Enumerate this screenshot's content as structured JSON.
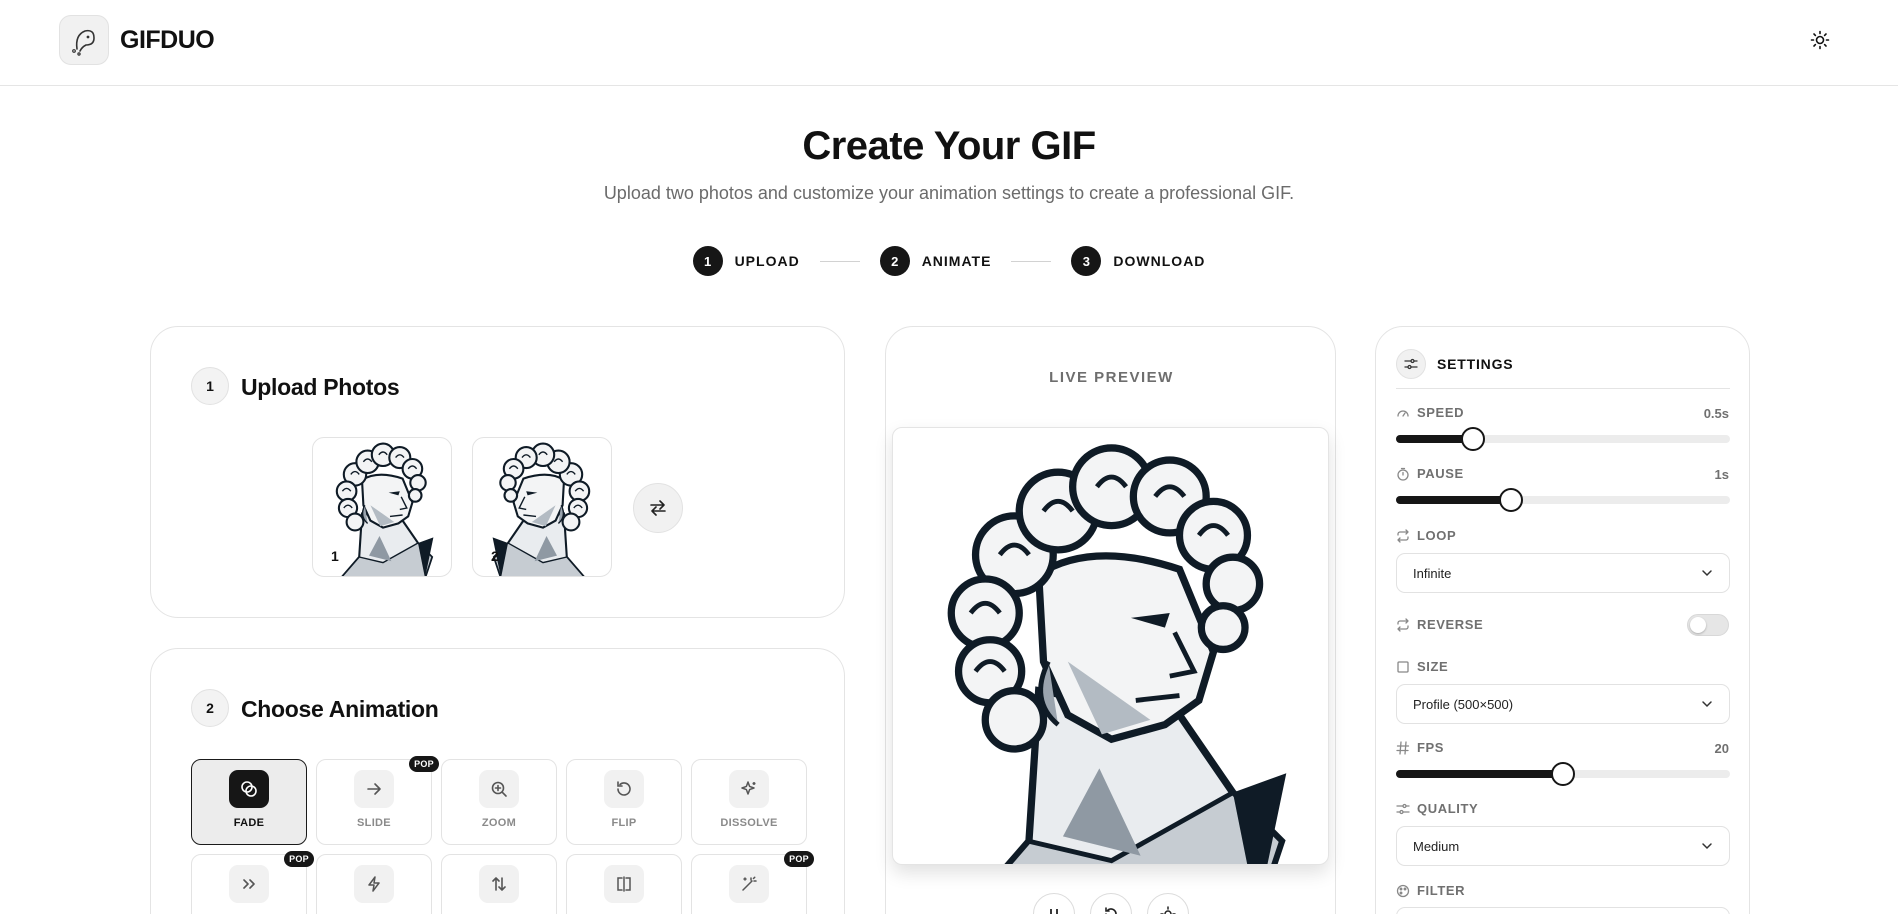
{
  "app": {
    "name": "GIFDUO"
  },
  "hero": {
    "title": "Create Your GIF",
    "subtitle": "Upload two photos and customize your animation settings to create a professional GIF."
  },
  "steps": [
    {
      "number": "1",
      "label": "UPLOAD"
    },
    {
      "number": "2",
      "label": "ANIMATE"
    },
    {
      "number": "3",
      "label": "DOWNLOAD"
    }
  ],
  "upload": {
    "number": "1",
    "title": "Upload Photos",
    "photos": [
      {
        "label": "1"
      },
      {
        "label": "2"
      }
    ]
  },
  "animation": {
    "number": "2",
    "title": "Choose Animation",
    "options": [
      {
        "label": "FADE",
        "icon": "fade-icon",
        "active": true
      },
      {
        "label": "SLIDE",
        "icon": "arrow-right-icon",
        "badge": "POP"
      },
      {
        "label": "ZOOM",
        "icon": "zoom-in-icon"
      },
      {
        "label": "FLIP",
        "icon": "rotate-icon"
      },
      {
        "label": "DISSOLVE",
        "icon": "sparkle-icon"
      },
      {
        "label": "",
        "icon": "double-chevron-icon",
        "badge": "POP"
      },
      {
        "label": "",
        "icon": "lightning-icon"
      },
      {
        "label": "",
        "icon": "swap-vertical-icon"
      },
      {
        "label": "",
        "icon": "split-icon"
      },
      {
        "label": "",
        "icon": "magic-wand-icon",
        "badge": "POP"
      }
    ]
  },
  "preview": {
    "label": "LIVE PREVIEW"
  },
  "settings": {
    "title": "SETTINGS",
    "speed": {
      "label": "SPEED",
      "value": "0.5s",
      "level": 0.23
    },
    "pause": {
      "label": "PAUSE",
      "value": "1s",
      "level": 0.345
    },
    "loop": {
      "label": "LOOP",
      "selected": "Infinite"
    },
    "reverse": {
      "label": "REVERSE",
      "enabled": false
    },
    "size": {
      "label": "SIZE",
      "selected": "Profile (500×500)"
    },
    "fps": {
      "label": "FPS",
      "value": "20",
      "level": 0.5
    },
    "quality": {
      "label": "QUALITY",
      "selected": "Medium"
    },
    "filter": {
      "label": "FILTER"
    }
  },
  "colors": {
    "accent": "#161616",
    "muted": "#707070",
    "border": "#e4e4e4"
  }
}
